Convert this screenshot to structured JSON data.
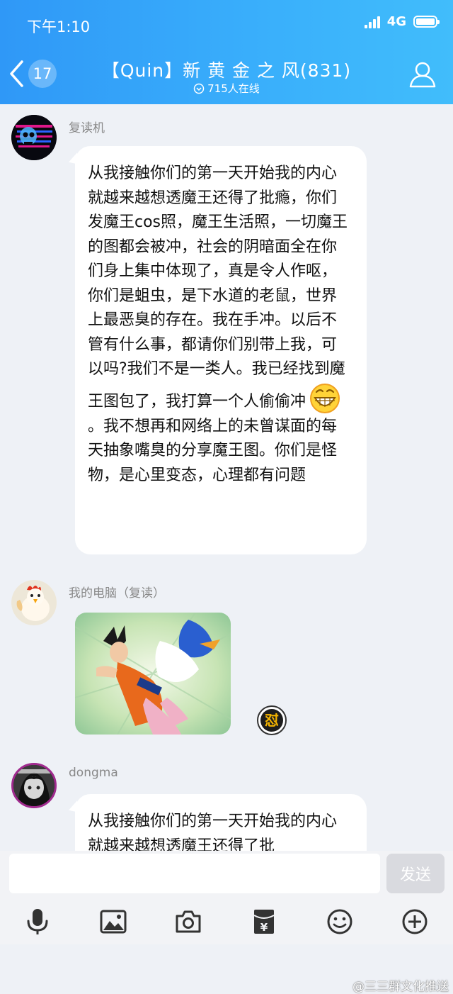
{
  "status_bar": {
    "time": "下午1:10",
    "network": "4G"
  },
  "header": {
    "unread_count": "17",
    "group_title": "【Quin】新 黄 金 之 风(831)",
    "online_text": "715人在线"
  },
  "messages": [
    {
      "sender": "复读机",
      "text_before_emoji": "从我接触你们的第一天开始我的内心就越来越想透魔王还得了批瘾，你们发魔王cos照，魔王生活照，一切魔王的图都会被冲，社会的阴暗面全在你们身上集中体现了，真是令人作呕，你们是蛆虫，是下水道的老鼠，世界上最恶臭的存在。我在手冲。以后不管有什么事，都请你们别带上我，可以吗?我们不是一类人。我已经找到魔王图包了，我打算一个人偷偷冲",
      "text_after_emoji": "。我不想再和网络上的未曾谋面的每天抽象嘴臭的分享魔王图。你们是怪物，是心里变态，心理都有问题",
      "emoji": "grinning-face-emoji"
    },
    {
      "sender": "我的电脑（复读）",
      "image": "dragon-ball-goku-donald-duck-meme",
      "sticker": "dui-sticker-badge"
    },
    {
      "sender": "dongma",
      "text": "从我接触你们的第一天开始我的内心就越来越想透魔王还得了批"
    }
  ],
  "input_bar": {
    "placeholder": "",
    "send_label": "发送"
  },
  "toolbar": {
    "icons": [
      "microphone-icon",
      "image-icon",
      "camera-icon",
      "red-packet-icon",
      "emoji-icon",
      "plus-icon"
    ]
  },
  "watermark": "@三三群文化推送",
  "colors": {
    "header_gradient_start": "#2f98f7",
    "header_gradient_end": "#41bdfb",
    "chat_background": "#eef1f6",
    "bubble": "#ffffff",
    "send_button": "#d9dadf",
    "toolbar_icon": "#333333"
  }
}
